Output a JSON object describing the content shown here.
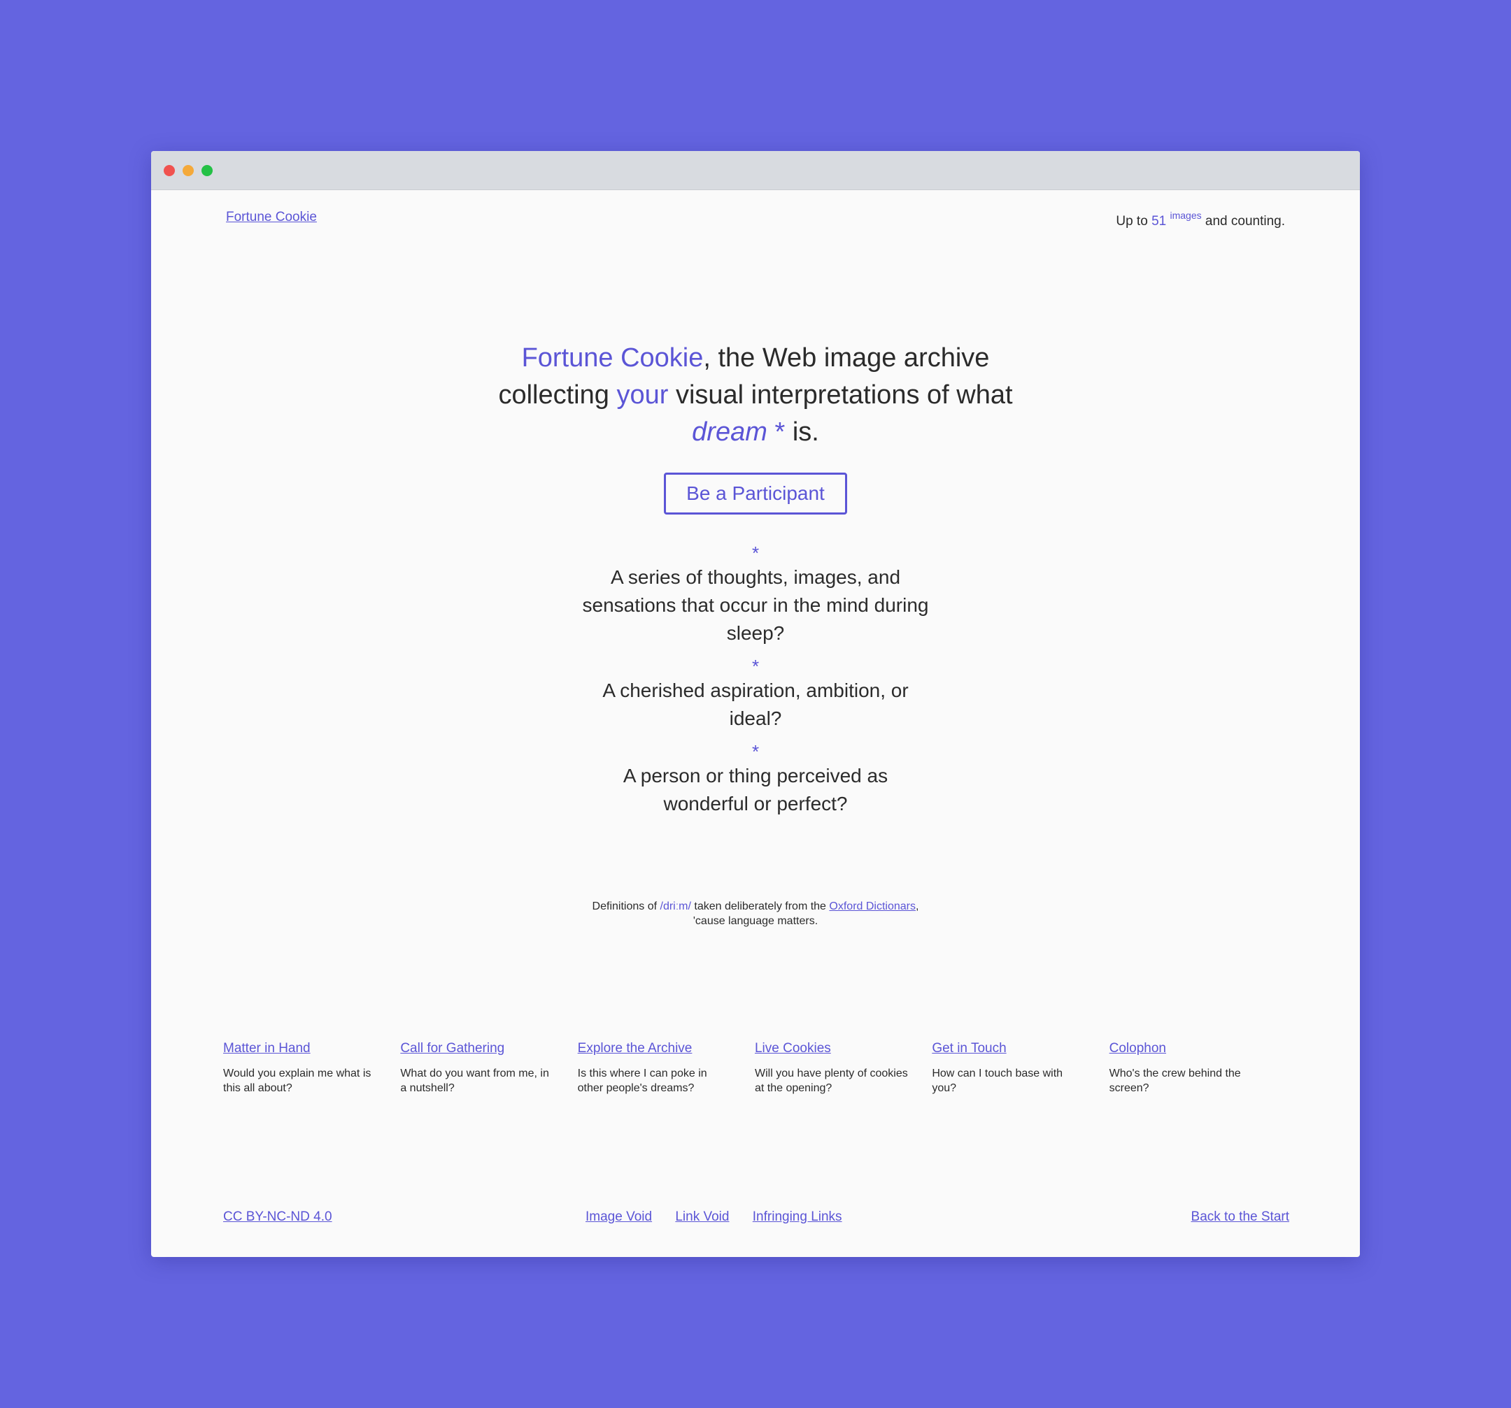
{
  "header": {
    "brand_link": "Fortune Cookie",
    "counter_prefix": "Up to",
    "counter_value": "51",
    "counter_unit": "images",
    "counter_suffix": "and counting."
  },
  "hero": {
    "brand": "Fortune Cookie",
    "part1": ", the Web image archive",
    "part2": "collecting",
    "your": "your",
    "part3": "visual interpretations of what",
    "dream": "dream",
    "star": "*",
    "part4": "is."
  },
  "cta": {
    "label": "Be a Participant"
  },
  "definitions": [
    {
      "star": "*",
      "text": "A series of thoughts, images, and sensations that occur in the mind during sleep?"
    },
    {
      "star": "*",
      "text": "A cherished aspiration, ambition, or ideal?"
    },
    {
      "star": "*",
      "text": "A person or thing perceived as wonderful or perfect?"
    }
  ],
  "note": {
    "prefix": "Definitions of",
    "phonetic": "/driːm/",
    "middle": "taken deliberately from the",
    "link": "Oxford Dictionars",
    "comma": ",",
    "line2": "'cause language matters."
  },
  "sections": [
    {
      "title": "Matter in Hand",
      "desc": "Would you explain me what is this all about?"
    },
    {
      "title": "Call for Gathering",
      "desc": "What do you want from me, in a nutshell?"
    },
    {
      "title": "Explore the Archive",
      "desc": "Is this where I can poke in other people's dreams?"
    },
    {
      "title": "Live Cookies",
      "desc": "Will you have plenty of cookies at the opening?"
    },
    {
      "title": "Get in Touch",
      "desc": "How can I touch base with you?"
    },
    {
      "title": "Colophon",
      "desc": "Who's the crew behind the screen?"
    }
  ],
  "footer": {
    "license": "CC BY-NC-ND 4.0",
    "links": [
      "Image Void",
      "Link Void",
      "Infringing Links"
    ],
    "back": "Back to the Start"
  },
  "colors": {
    "background": "#6464e0",
    "accent": "#5b55d6",
    "page": "#fafafa",
    "titlebar": "#d8dbe0"
  }
}
